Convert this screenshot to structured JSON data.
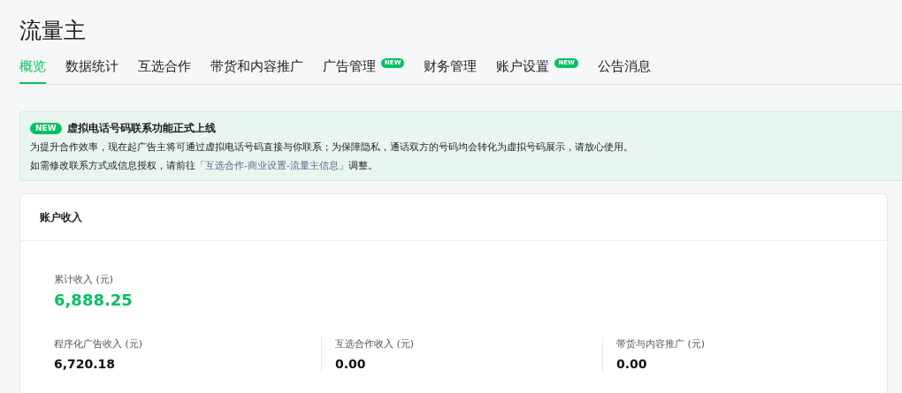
{
  "page": {
    "title": "流量主"
  },
  "tabs": [
    {
      "label": "概览",
      "selected": true
    },
    {
      "label": "数据统计",
      "selected": false
    },
    {
      "label": "互选合作",
      "selected": false
    },
    {
      "label": "带货和内容推广",
      "selected": false
    },
    {
      "label": "广告管理",
      "selected": false,
      "badge": "NEW"
    },
    {
      "label": "财务管理",
      "selected": false
    },
    {
      "label": "账户设置",
      "selected": false,
      "badge": "NEW"
    },
    {
      "label": "公告消息",
      "selected": false
    }
  ],
  "notice": {
    "badge": "NEW",
    "title": "虚拟电话号码联系功能正式上线",
    "line_1": "为提升合作效率，现在起广告主将可通过虚拟电话号码直接与你联系；为保障隐私，通话双方的号码均会转化为虚拟号码展示，请放心使用。",
    "line_2_before": "如需修改联系方式或信息授权，请前往",
    "line_2_link": "「互选合作-商业设置-流量主信息」",
    "line_2_after": "调整。"
  },
  "income_card": {
    "title": "账户收入",
    "total_label": "累计收入 (元)",
    "total_value": "6,888.25",
    "items": [
      {
        "label": "程序化广告收入 (元)",
        "value": "6,720.18"
      },
      {
        "label": "互选合作收入 (元)",
        "value": "0.00"
      },
      {
        "label": "带货与内容推广 (元)",
        "value": "0.00"
      }
    ]
  }
}
